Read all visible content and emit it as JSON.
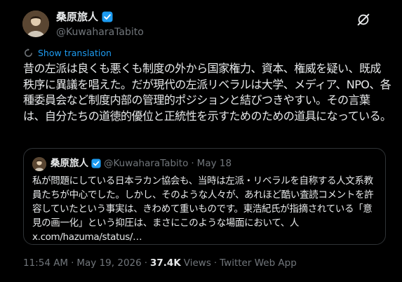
{
  "author": {
    "display_name": "桑原旅人",
    "handle": "@KuwaharaTabito",
    "avatar_icon": "profile-photo",
    "verified_icon": "verified-badge-icon"
  },
  "actions": {
    "grok_icon": "grok-icon"
  },
  "translation": {
    "label": "Show translation",
    "icon": "translate-icon"
  },
  "tweet": {
    "text": "昔の左派は良くも悪くも制度の外から国家権力、資本、権威を疑い、既成秩序に異議を唱えた。だが現代の左派リベラルは大学、メディア、NPO、各種委員会など制度内部の管理的ポジションと結びつきやすい。その言葉は、自分たちの道徳的優位と正統性を示すためのための道具になっている。"
  },
  "quote": {
    "display_name": "桑原旅人",
    "handle": "@KuwaharaTabito",
    "separator": "·",
    "date": "May 18",
    "text": "私が問題にしている日本ラカン協会も、当時は左派・リベラルを自称する人文系教員たちが中心でした。しかし、そのような人々が、あれほど酷い査読コメントを許容していたという事実は、きわめて重いものです。東浩紀氏が指摘されている「意見の画一化」という抑圧は、まさにこのような場面において、人\nx.com/hazuma/status/…"
  },
  "meta": {
    "time": "11:54 AM",
    "sep1": "·",
    "date": "May 19, 2026",
    "sep2": "·",
    "views_count": "37.4K",
    "views_label": "Views",
    "sep3": "·",
    "source": "Twitter Web App"
  },
  "colors": {
    "background": "#000000",
    "text": "#e7e9ea",
    "secondary": "#71767b",
    "link": "#1d9bf0",
    "border": "#2f3336"
  }
}
